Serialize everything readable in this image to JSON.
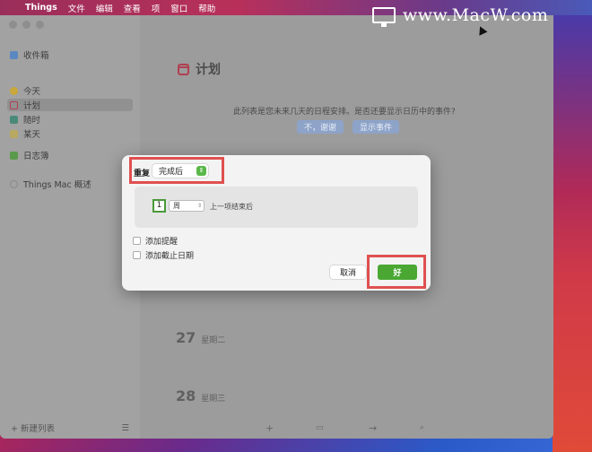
{
  "menubar": {
    "app": "Things",
    "items": [
      "文件",
      "编辑",
      "查看",
      "项",
      "窗口",
      "帮助"
    ]
  },
  "watermark": {
    "text": "www.MacW.com"
  },
  "sidebar": {
    "inbox": "收件箱",
    "today": "今天",
    "upcoming": "计划",
    "anytime": "随时",
    "someday": "某天",
    "logbook": "日志簿",
    "area": "Things Mac 概述",
    "new_list": "+ 新建列表"
  },
  "main": {
    "title": "计划",
    "notice": "此列表是您未来几天的日程安排。是否还要显示日历中的事件?",
    "btn_no": "不，谢谢",
    "btn_show": "显示事件",
    "days": [
      {
        "num": "27",
        "weekday": "星期二"
      },
      {
        "num": "28",
        "weekday": "星期三"
      }
    ]
  },
  "modal": {
    "repeat_label": "重复",
    "repeat_mode": "完成后",
    "interval_value": "1",
    "interval_unit": "周",
    "interval_suffix": "上一项结束后",
    "add_reminder": "添加提醒",
    "add_deadline": "添加截止日期",
    "cancel": "取消",
    "ok": "好"
  },
  "colors": {
    "ok_green": "#4aa832",
    "highlight": "#e05050"
  }
}
